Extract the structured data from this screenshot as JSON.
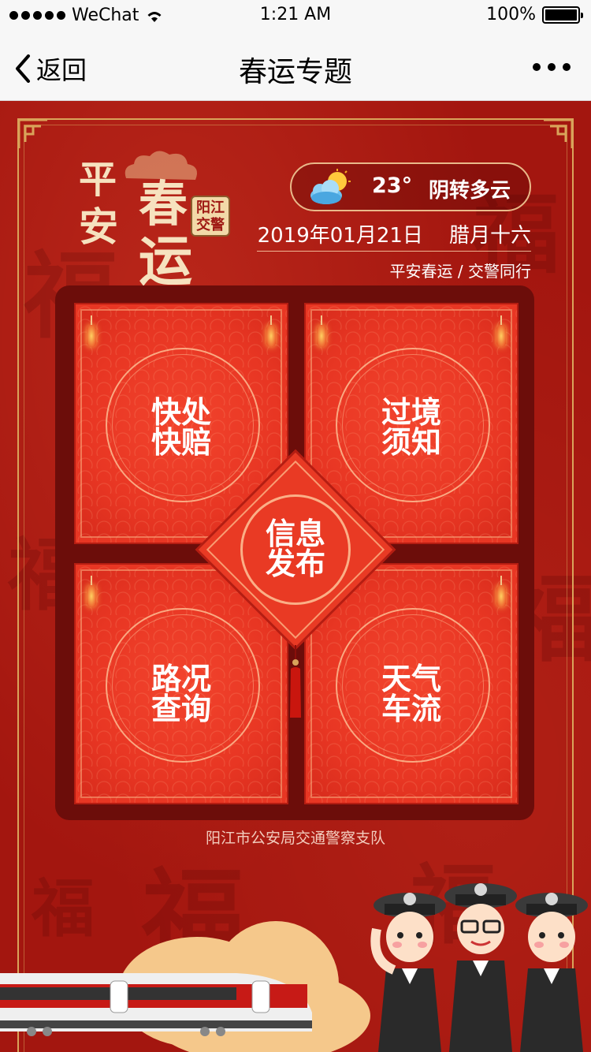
{
  "status_bar": {
    "carrier": "WeChat",
    "time": "1:21 AM",
    "battery": "100%"
  },
  "nav": {
    "back_label": "返回",
    "title": "春运专题"
  },
  "logo": {
    "chars": [
      "平",
      "安",
      "春",
      "运"
    ],
    "badge_line1": "阳江",
    "badge_line2": "交警"
  },
  "weather": {
    "temperature": "23°",
    "description": "阴转多云"
  },
  "date": {
    "gregorian": "2019年01月21日",
    "lunar": "腊月十六"
  },
  "slogan": "平安春运 / 交警同行",
  "menu": {
    "quick_claim": [
      "快处",
      "快赔"
    ],
    "border_notice": [
      "过境",
      "须知"
    ],
    "info_release": [
      "信息",
      "发布"
    ],
    "road_status": [
      "路况",
      "查询"
    ],
    "weather_traffic": [
      "天气",
      "车流"
    ]
  },
  "footer": "阳江市公安局交通警察支队",
  "background_glyph": "福",
  "colors": {
    "background": "#a3160f",
    "panel": "#6c0d0a",
    "card": "#e83623",
    "gold": "#d9a35a"
  }
}
